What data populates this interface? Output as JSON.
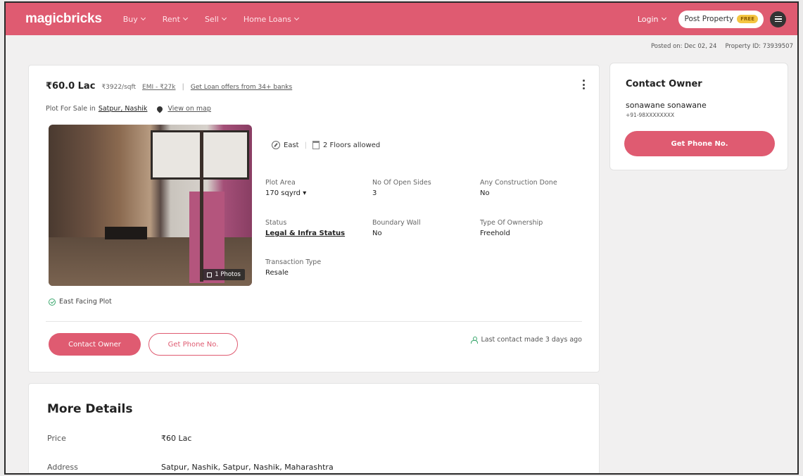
{
  "header": {
    "logo": "magicbricks",
    "nav": [
      "Buy",
      "Rent",
      "Sell",
      "Home Loans"
    ],
    "login": "Login",
    "post_property": "Post Property",
    "post_badge": "FREE"
  },
  "meta": {
    "posted_on": "Posted on: Dec 02, 24",
    "property_id": "Property ID: 73939507"
  },
  "listing": {
    "price": "₹60.0 Lac",
    "price_per_sqft": "₹3922/sqft",
    "emi": "EMI - ₹27k",
    "separator": "|",
    "loan_offers": "Get Loan offers from 34+ banks",
    "location_prefix": "Plot For Sale in",
    "location_link": "Satpur, Nashik",
    "map_link": "View on map",
    "photo_count": "1 Photos",
    "facing": "East",
    "floors_allowed": "2 Floors allowed",
    "details": [
      {
        "label": "Plot Area",
        "value": "170 sqyrd ▾"
      },
      {
        "label": "No Of Open Sides",
        "value": "3"
      },
      {
        "label": "Any Construction Done",
        "value": "No"
      },
      {
        "label": "Status",
        "value": "Legal & Infra Status"
      },
      {
        "label": "Boundary Wall",
        "value": "No"
      },
      {
        "label": "Type Of Ownership",
        "value": "Freehold"
      },
      {
        "label": "Transaction Type",
        "value": "Resale"
      }
    ],
    "highlight": "East Facing Plot",
    "contact_owner_btn": "Contact Owner",
    "get_phone_btn": "Get Phone No.",
    "last_contact": "Last contact made 3 days ago"
  },
  "owner": {
    "title": "Contact Owner",
    "name": "sonawane sonawane",
    "phone": "+91-98XXXXXXXX",
    "button": "Get Phone No."
  },
  "more_details": {
    "title": "More Details",
    "rows": [
      {
        "key": "Price",
        "value": "₹60 Lac"
      },
      {
        "key": "Address",
        "value": "Satpur, Nashik, Satpur, Nashik, Maharashtra"
      }
    ]
  },
  "colors": {
    "brand": "#df5b71",
    "success": "#3aa76d"
  }
}
